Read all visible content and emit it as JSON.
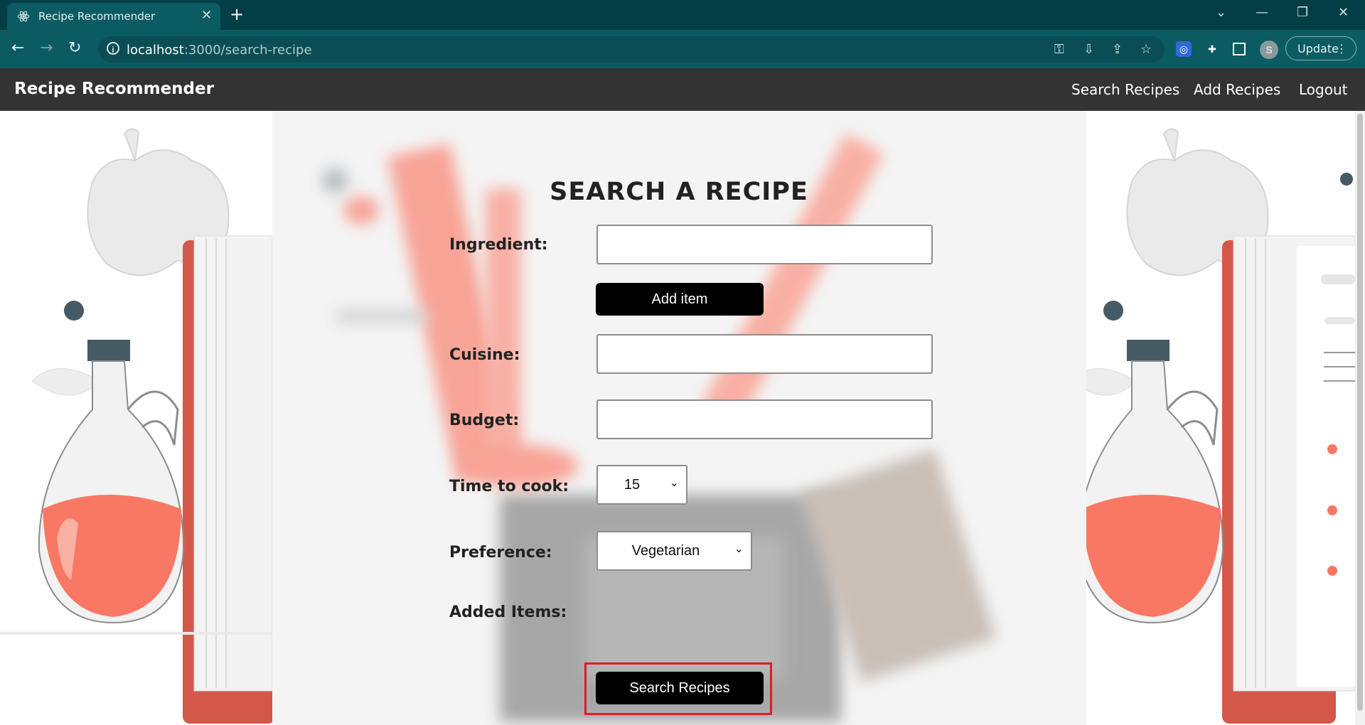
{
  "browser": {
    "tab_title": "Recipe Recommender",
    "tab_close": "✕",
    "new_tab": "+",
    "window_controls": [
      "⌄",
      "—",
      "❐",
      "✕"
    ],
    "url_host": "localhost",
    "url_path": ":3000/search-recipe",
    "update_label": "Update",
    "profile_initial": "S"
  },
  "navbar": {
    "brand": "Recipe Recommender",
    "links": [
      "Search Recipes",
      "Add Recipes",
      "Logout"
    ]
  },
  "form": {
    "heading": "SEARCH A RECIPE",
    "ingredient_label": "Ingredient:",
    "add_item_label": "Add item",
    "cuisine_label": "Cuisine:",
    "budget_label": "Budget:",
    "time_label": "Time to cook:",
    "time_value": "15",
    "preference_label": "Preference:",
    "preference_value": "Vegetarian",
    "added_items_label": "Added Items:",
    "search_button": "Search Recipes"
  },
  "colors": {
    "navbar": "#333333",
    "chrome": "#0b5b62",
    "accent_red": "#e0695c",
    "highlight": "#e01c24"
  }
}
